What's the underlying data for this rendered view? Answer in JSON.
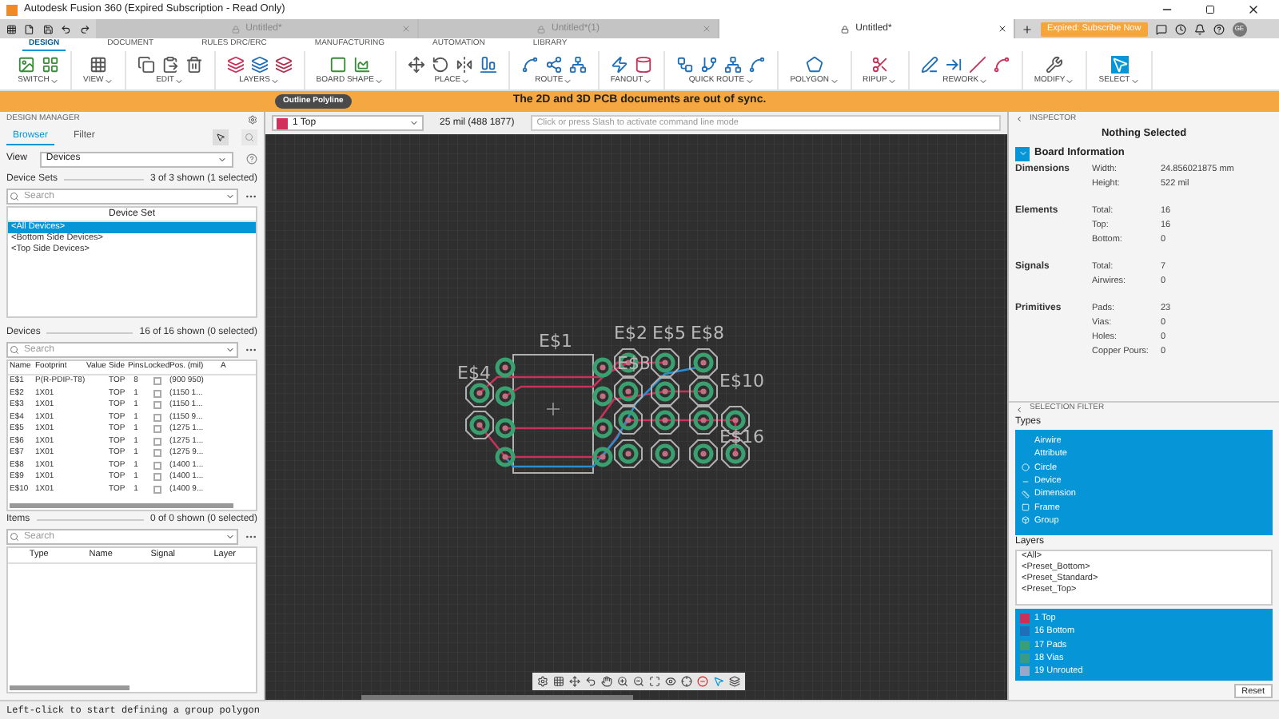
{
  "window": {
    "title": "Autodesk Fusion 360 (Expired Subscription - Read Only)"
  },
  "doc_tabs": [
    {
      "label": "Untitled*",
      "selected": false
    },
    {
      "label": "Untitled*(1)",
      "selected": false
    },
    {
      "label": "Untitled*",
      "selected": true
    }
  ],
  "subscribe_button": "Expired: Subscribe Now",
  "user_initials": "GE",
  "ribbon_tabs": [
    {
      "label": "DESIGN",
      "selected": true
    },
    {
      "label": "DOCUMENT",
      "selected": false
    },
    {
      "label": "RULES DRC/ERC",
      "selected": false
    },
    {
      "label": "MANUFACTURING",
      "selected": false
    },
    {
      "label": "AUTOMATION",
      "selected": false
    },
    {
      "label": "LIBRARY",
      "selected": false
    }
  ],
  "toolbar_groups": [
    "SWITCH",
    "VIEW",
    "EDIT",
    "LAYERS",
    "BOARD SHAPE",
    "PLACE",
    "ROUTE",
    "FANOUT",
    "QUICK ROUTE",
    "POLYGON",
    "RIPUP",
    "REWORK",
    "MODIFY",
    "SELECT"
  ],
  "banner": {
    "tool_name": "Outline Polyline",
    "message": "The 2D and 3D PCB documents are out of sync."
  },
  "design_manager": {
    "title": "DESIGN MANAGER",
    "tabs": [
      {
        "label": "Browser",
        "selected": true
      },
      {
        "label": "Filter",
        "selected": false
      }
    ],
    "view_label": "View",
    "view_value": "Devices",
    "device_sets": {
      "label": "Device Sets",
      "count": "3 of 3 shown (1 selected)",
      "search_placeholder": "Search",
      "column": "Device Set",
      "items": [
        {
          "label": "<All Devices>",
          "selected": true
        },
        {
          "label": "<Bottom Side Devices>",
          "selected": false
        },
        {
          "label": "<Top Side Devices>",
          "selected": false
        }
      ]
    },
    "devices": {
      "label": "Devices",
      "count": "16 of 16 shown (0 selected)",
      "search_placeholder": "Search",
      "columns": [
        "Name",
        "Footprint",
        "Value",
        "Side",
        "Pins",
        "Locked",
        "Pos. (mil)",
        "A"
      ],
      "rows": [
        {
          "name": "E$1",
          "footprint": "P(R-PDIP-T8)",
          "side": "TOP",
          "pins": "8",
          "locked": false,
          "pos": "(900 950)"
        },
        {
          "name": "E$2",
          "footprint": "1X01",
          "side": "TOP",
          "pins": "1",
          "locked": false,
          "pos": "(1150 1..."
        },
        {
          "name": "E$3",
          "footprint": "1X01",
          "side": "TOP",
          "pins": "1",
          "locked": false,
          "pos": "(1150 1..."
        },
        {
          "name": "E$4",
          "footprint": "1X01",
          "side": "TOP",
          "pins": "1",
          "locked": false,
          "pos": "(1150 9..."
        },
        {
          "name": "E$5",
          "footprint": "1X01",
          "side": "TOP",
          "pins": "1",
          "locked": false,
          "pos": "(1275 1..."
        },
        {
          "name": "E$6",
          "footprint": "1X01",
          "side": "TOP",
          "pins": "1",
          "locked": false,
          "pos": "(1275 1..."
        },
        {
          "name": "E$7",
          "footprint": "1X01",
          "side": "TOP",
          "pins": "1",
          "locked": false,
          "pos": "(1275 9..."
        },
        {
          "name": "E$8",
          "footprint": "1X01",
          "side": "TOP",
          "pins": "1",
          "locked": false,
          "pos": "(1400 1..."
        },
        {
          "name": "E$9",
          "footprint": "1X01",
          "side": "TOP",
          "pins": "1",
          "locked": false,
          "pos": "(1400 1..."
        },
        {
          "name": "E$10",
          "footprint": "1X01",
          "side": "TOP",
          "pins": "1",
          "locked": false,
          "pos": "(1400 9..."
        }
      ]
    },
    "items": {
      "label": "Items",
      "count": "0 of 0 shown (0 selected)",
      "search_placeholder": "Search",
      "columns": [
        "Type",
        "Name",
        "Signal",
        "Layer"
      ]
    }
  },
  "command_bar": {
    "layer": "1 Top",
    "reading": "25 mil (488 1877)",
    "placeholder": "Click or press Slash to activate command line mode"
  },
  "canvas": {
    "labels": [
      "E$1",
      "E$4",
      "E$2",
      "E$5",
      "E$8",
      "E$3",
      "E$10",
      "E$16"
    ]
  },
  "inspector": {
    "title": "INSPECTOR",
    "heading": "Nothing Selected",
    "section": "Board Information",
    "groups": [
      {
        "label": "Dimensions",
        "rows": [
          {
            "key": "Width:",
            "value": "24.856021875 mm"
          },
          {
            "key": "Height:",
            "value": "522 mil"
          }
        ]
      },
      {
        "label": "Elements",
        "rows": [
          {
            "key": "Total:",
            "value": "16"
          },
          {
            "key": "Top:",
            "value": "16"
          },
          {
            "key": "Bottom:",
            "value": "0"
          }
        ]
      },
      {
        "label": "Signals",
        "rows": [
          {
            "key": "Total:",
            "value": "7"
          },
          {
            "key": "Airwires:",
            "value": "0"
          }
        ]
      },
      {
        "label": "Primitives",
        "rows": [
          {
            "key": "Pads:",
            "value": "23"
          },
          {
            "key": "Vias:",
            "value": "0"
          },
          {
            "key": "Holes:",
            "value": "0"
          },
          {
            "key": "Copper Pours:",
            "value": "0"
          }
        ]
      }
    ]
  },
  "selection_filter": {
    "title": "SELECTION FILTER",
    "types_label": "Types",
    "types": [
      {
        "label": "Airwire",
        "selected": true
      },
      {
        "label": "Attribute",
        "selected": true
      },
      {
        "label": "Circle",
        "selected": true
      },
      {
        "label": "Device",
        "selected": true
      },
      {
        "label": "Dimension",
        "selected": true
      },
      {
        "label": "Frame",
        "selected": true
      },
      {
        "label": "Group",
        "selected": true
      }
    ],
    "layers_label": "Layers",
    "presets": [
      {
        "label": "<All>",
        "selected": false
      },
      {
        "label": "<Preset_Bottom>",
        "selected": false
      },
      {
        "label": "<Preset_Standard>",
        "selected": false
      },
      {
        "label": "<Preset_Top>",
        "selected": false
      }
    ],
    "layers": [
      {
        "label": "1 Top",
        "color": "#c8325a",
        "selected": true
      },
      {
        "label": "16 Bottom",
        "color": "#1f6fb8",
        "selected": true
      },
      {
        "label": "17 Pads",
        "color": "#3aa070",
        "selected": true
      },
      {
        "label": "18 Vias",
        "color": "#3a9a88",
        "selected": true
      },
      {
        "label": "19 Unrouted",
        "color": "#9aa8c8",
        "selected": true
      }
    ],
    "reset_button": "Reset"
  },
  "status_bar": "Left-click to start defining a group polygon"
}
